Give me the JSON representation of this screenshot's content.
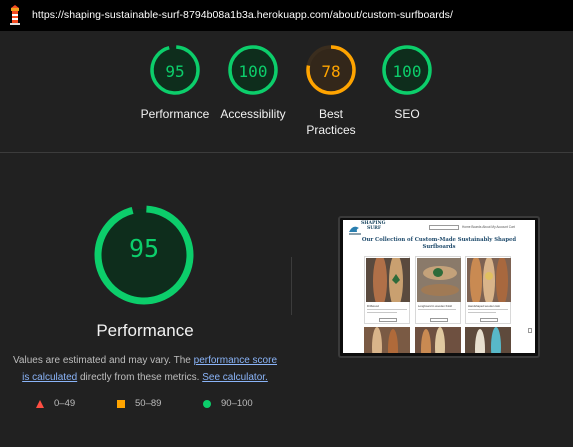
{
  "topbar": {
    "url": "https://shaping-sustainable-surf-8794b08a1b3a.herokuapp.com/about/custom-surfboards/",
    "logo_icon": "lighthouse-icon"
  },
  "colors": {
    "pass": "#0cce6b",
    "average": "#ffa400",
    "fail": "#ff4e42",
    "background": "#212121"
  },
  "categories": [
    {
      "id": "performance",
      "label": "Performance",
      "score": 95,
      "status": "pass"
    },
    {
      "id": "accessibility",
      "label": "Accessibility",
      "score": 100,
      "status": "pass"
    },
    {
      "id": "best-practices",
      "label_line1": "Best",
      "label_line2": "Practices",
      "score": 78,
      "status": "average"
    },
    {
      "id": "seo",
      "label": "SEO",
      "score": 100,
      "status": "pass"
    }
  ],
  "main": {
    "score": 95,
    "title": "Performance",
    "desc_part1": "Values are estimated and may vary. The ",
    "desc_link1_a": "performance score",
    "desc_link1_b": "is calculated",
    "desc_part2": " directly from these metrics. ",
    "desc_link2": "See calculator."
  },
  "legend": [
    {
      "shape": "triangle",
      "range": "0–49"
    },
    {
      "shape": "square",
      "range": "50–89"
    },
    {
      "shape": "circle",
      "range": "90–100"
    }
  ],
  "thumbnail": {
    "brand_line1": "SHAPING",
    "brand_line2": "SURF",
    "search_placeholder": "Search boards",
    "nav": "Home  Boards  About  My Account  Cart",
    "heading_line1": "Our Collection of Custom-Made Sustainably Shaped",
    "heading_line2": "Surfboards",
    "cards": [
      {
        "caption": "Driftwood"
      },
      {
        "caption": "Longboard in wooden finish"
      },
      {
        "caption": "Handshaped wooden twin"
      }
    ]
  }
}
